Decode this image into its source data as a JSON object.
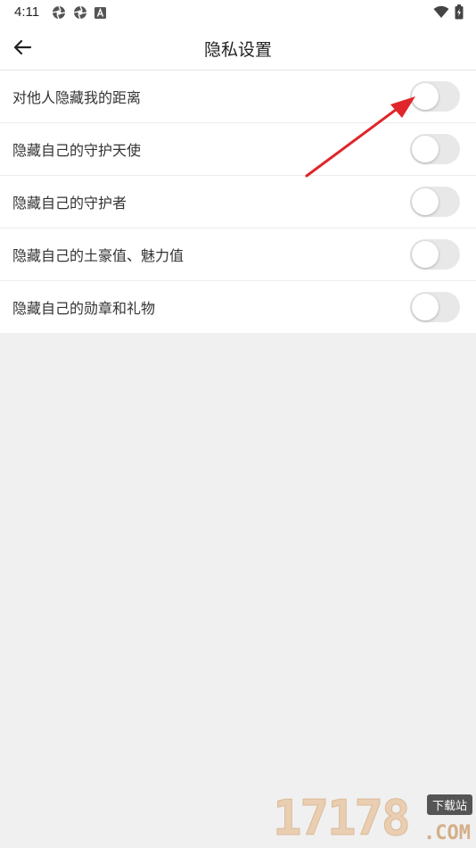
{
  "status_bar": {
    "time": "4:11",
    "left_icons": [
      "aperture-icon",
      "aperture-icon",
      "font-icon"
    ],
    "right_icons": [
      "wifi-icon",
      "battery-icon"
    ]
  },
  "header": {
    "title": "隐私设置",
    "back_icon": "arrow-left-icon"
  },
  "settings": [
    {
      "label": "对他人隐藏我的距离",
      "enabled": false
    },
    {
      "label": "隐藏自己的守护天使",
      "enabled": false
    },
    {
      "label": "隐藏自己的守护者",
      "enabled": false
    },
    {
      "label": "隐藏自己的土豪值、魅力值",
      "enabled": false
    },
    {
      "label": "隐藏自己的勋章和礼物",
      "enabled": false
    }
  ],
  "colors": {
    "background": "#f0f0f0",
    "toggle_off": "#e8e8e8",
    "annotation_arrow": "#e0262a"
  },
  "watermark": {
    "digits": "17178",
    "badge": "下载站",
    "suffix": ".COM"
  }
}
